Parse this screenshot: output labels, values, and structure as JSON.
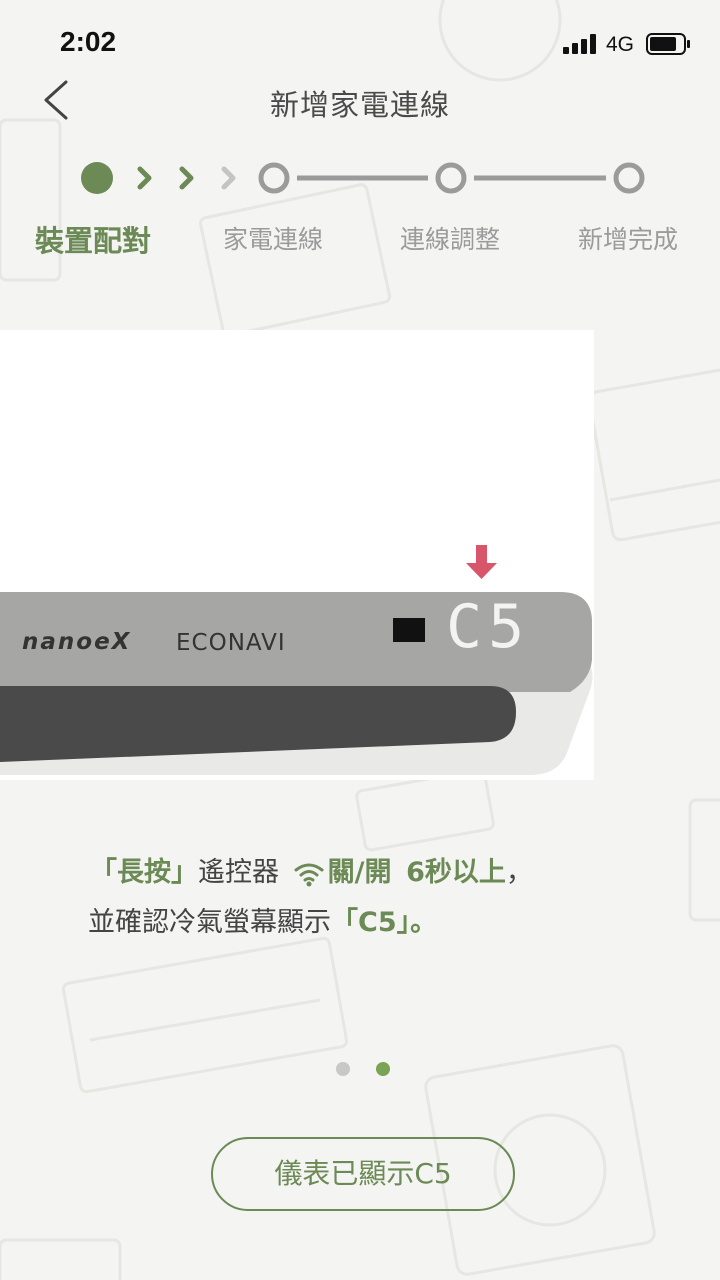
{
  "status_bar": {
    "time": "2:02",
    "network": "4G"
  },
  "nav": {
    "title": "新增家電連線"
  },
  "stepper": {
    "steps": [
      {
        "label": "裝置配對",
        "state": "active"
      },
      {
        "label": "家電連線",
        "state": "pending"
      },
      {
        "label": "連線調整",
        "state": "pending"
      },
      {
        "label": "新增完成",
        "state": "pending"
      }
    ]
  },
  "illustration": {
    "brand_1": "nanoeX",
    "brand_2": "ECONAVI",
    "display_code": "C5"
  },
  "instruction": {
    "bracket_open": "「",
    "press_action": "長按",
    "bracket_close": "」",
    "remote_text": "遙控器",
    "button_name": "關/開",
    "duration_text": "6秒以上",
    "tail_1": "，",
    "line2_prefix": "並確認冷氣螢幕顯示",
    "line2_code": "C5",
    "line2_suffix": "」。"
  },
  "pager": {
    "total": 2,
    "current": 2
  },
  "action_button": {
    "label": "儀表已顯示C5"
  },
  "colors": {
    "accent": "#6c8a55",
    "accent_light": "#7aa356",
    "arrow": "#d9556a",
    "inactive": "#9b9b9b",
    "background": "#f4f4f2"
  },
  "icons": [
    "back-arrow-icon",
    "signal-icon",
    "battery-icon",
    "wifi-icon",
    "down-arrow-icon"
  ]
}
